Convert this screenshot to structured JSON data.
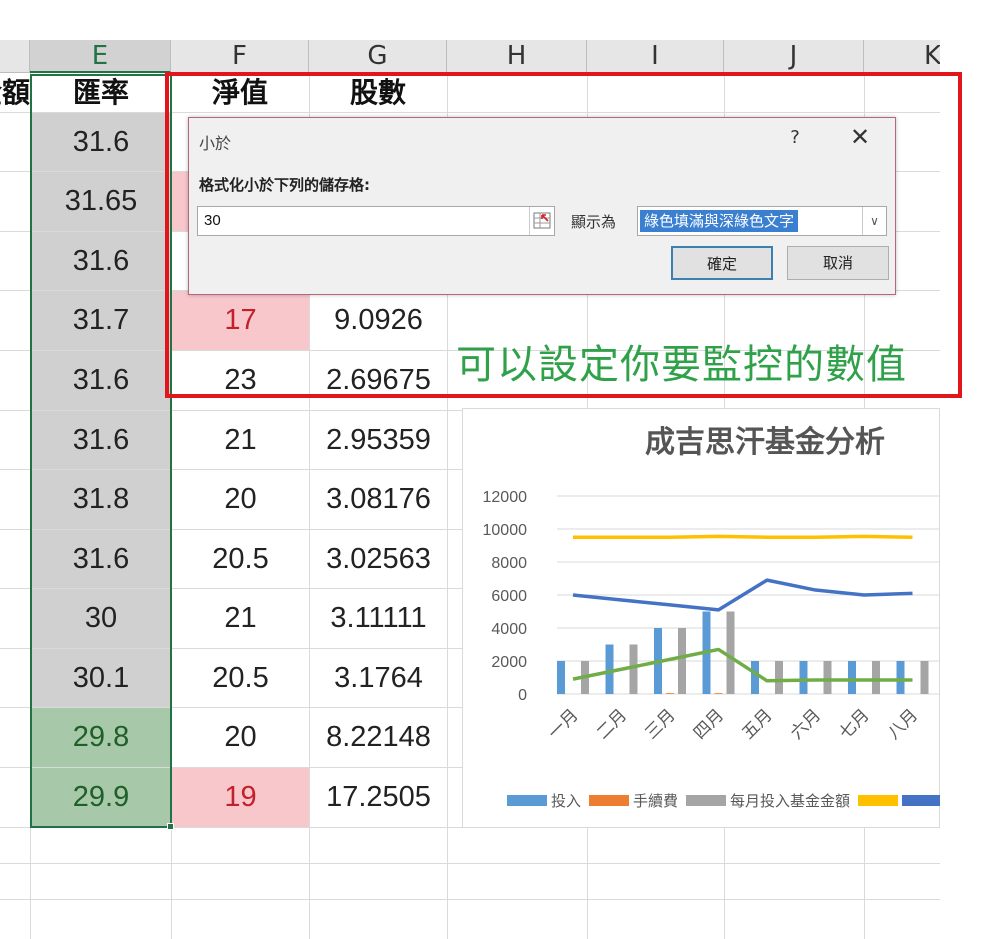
{
  "sheet": {
    "columns": [
      {
        "label": "E",
        "selected": true
      },
      {
        "label": "F",
        "selected": false
      },
      {
        "label": "G",
        "selected": false
      },
      {
        "label": "H",
        "selected": false
      },
      {
        "label": "I",
        "selected": false
      },
      {
        "label": "J",
        "selected": false
      },
      {
        "label": "K",
        "selected": false
      }
    ],
    "partial_left_header": "金額",
    "headers": {
      "e": "匯率",
      "f": "淨值",
      "g": "股數"
    },
    "rows": [
      {
        "e": "31.6",
        "f": "",
        "g": "",
        "e_fill": "gray",
        "f_fill": "none"
      },
      {
        "e": "31.65",
        "f": "",
        "g": "",
        "e_fill": "gray",
        "f_fill": "pink"
      },
      {
        "e": "31.6",
        "f": "",
        "g": "",
        "e_fill": "gray",
        "f_fill": "none"
      },
      {
        "e": "31.7",
        "f": "17",
        "g": "9.0926",
        "e_fill": "gray",
        "f_fill": "pink"
      },
      {
        "e": "31.6",
        "f": "23",
        "g": "2.69675",
        "e_fill": "gray",
        "f_fill": "none"
      },
      {
        "e": "31.6",
        "f": "21",
        "g": "2.95359",
        "e_fill": "gray",
        "f_fill": "none"
      },
      {
        "e": "31.8",
        "f": "20",
        "g": "3.08176",
        "e_fill": "gray",
        "f_fill": "none"
      },
      {
        "e": "31.6",
        "f": "20.5",
        "g": "3.02563",
        "e_fill": "gray",
        "f_fill": "none"
      },
      {
        "e": "30",
        "f": "21",
        "g": "3.11111",
        "e_fill": "gray",
        "f_fill": "none"
      },
      {
        "e": "30.1",
        "f": "20.5",
        "g": "3.1764",
        "e_fill": "gray",
        "f_fill": "none"
      },
      {
        "e": "29.8",
        "f": "20",
        "g": "8.22148",
        "e_fill": "green",
        "f_fill": "none"
      },
      {
        "e": "29.9",
        "f": "19",
        "g": "17.2505",
        "e_fill": "green",
        "f_fill": "pink"
      }
    ]
  },
  "dialog": {
    "title": "小於",
    "help": "?",
    "close": "✕",
    "prompt": "格式化小於下列的儲存格:",
    "input_value": "30",
    "show_as_label": "顯示為",
    "format_option": "綠色填滿與深綠色文字",
    "ok_label": "確定",
    "cancel_label": "取消"
  },
  "annotation": "可以設定你要監控的數值",
  "chart_data": {
    "type": "bar",
    "title": "成吉思汗基金分析",
    "categories": [
      "一月",
      "二月",
      "三月",
      "四月",
      "五月",
      "六月",
      "七月",
      "八月"
    ],
    "ylim": [
      0,
      12000
    ],
    "yticks": [
      "0",
      "2000",
      "4000",
      "6000",
      "8000",
      "10000",
      "12000"
    ],
    "legend_position": "bottom",
    "series": [
      {
        "name": "投入",
        "kind": "bar",
        "color": "#5b9bd5",
        "values": [
          2000,
          3000,
          4000,
          5000,
          2000,
          2000,
          2000,
          2000
        ]
      },
      {
        "name": "手續費",
        "kind": "bar",
        "color": "#ed7d31",
        "values": [
          0,
          0,
          50,
          50,
          0,
          0,
          0,
          0
        ]
      },
      {
        "name": "每月投入基金金額",
        "kind": "bar",
        "color": "#a5a5a5",
        "values": [
          2000,
          3000,
          4000,
          5000,
          2000,
          2000,
          2000,
          2000
        ]
      },
      {
        "name": "",
        "kind": "line",
        "color": "#ffc000",
        "values": [
          9500,
          9500,
          9500,
          9550,
          9500,
          9500,
          9550,
          9500
        ]
      },
      {
        "name": "",
        "kind": "line",
        "color": "#4472c4",
        "values": [
          6000,
          5700,
          5400,
          5100,
          6900,
          6300,
          6000,
          6100
        ]
      },
      {
        "name": "",
        "kind": "line",
        "color": "#70ad47",
        "values": [
          900,
          1500,
          2100,
          2700,
          800,
          850,
          850,
          850
        ]
      }
    ]
  }
}
